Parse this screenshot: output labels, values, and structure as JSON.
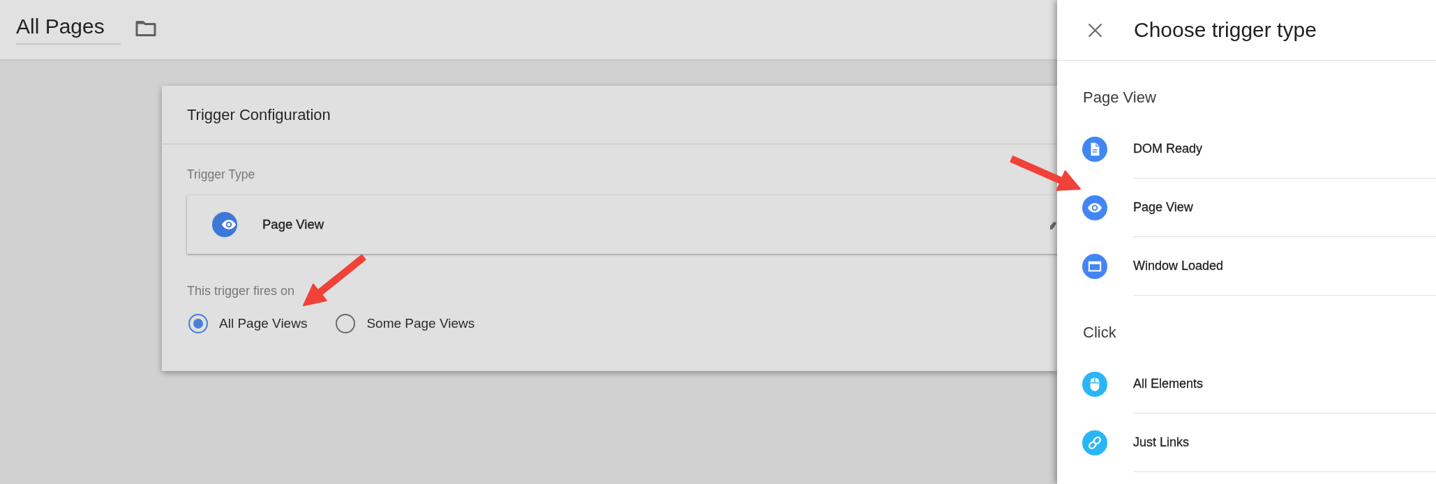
{
  "header": {
    "title": "All Pages"
  },
  "trigger_configuration": {
    "title": "Trigger Configuration",
    "trigger_type_label": "Trigger Type",
    "trigger_type": {
      "label": "Page View",
      "kind": "eye"
    },
    "fires_on_label": "This trigger fires on",
    "fires_on_options": [
      {
        "label": "All Page Views",
        "selected": true
      },
      {
        "label": "Some Page Views",
        "selected": false
      }
    ]
  },
  "trigger_type_panel": {
    "title": "Choose trigger type",
    "sections": [
      {
        "title": "Page View",
        "items": [
          {
            "label": "DOM Ready",
            "kind": "document",
            "color": "#4285f4"
          },
          {
            "label": "Page View",
            "kind": "eye",
            "color": "#4285f4"
          },
          {
            "label": "Window Loaded",
            "kind": "window",
            "color": "#4285f4"
          }
        ]
      },
      {
        "title": "Click",
        "items": [
          {
            "label": "All Elements",
            "kind": "mouse",
            "color": "#29b6f6"
          },
          {
            "label": "Just Links",
            "kind": "link",
            "color": "#29b6f6"
          }
        ]
      }
    ]
  }
}
